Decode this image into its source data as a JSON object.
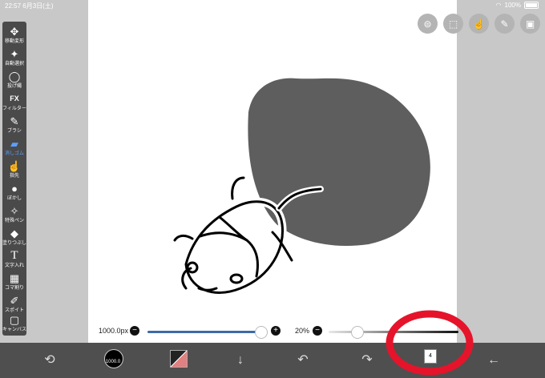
{
  "status": {
    "time": "22:57",
    "date": "6月3日(土)",
    "battery": "100%"
  },
  "tools": [
    {
      "name": "move",
      "label": "移動変形",
      "icon": "✥"
    },
    {
      "name": "autoselect",
      "label": "自動選択",
      "icon": "✦"
    },
    {
      "name": "lasso",
      "label": "投げ縄",
      "icon": "◯"
    },
    {
      "name": "filter",
      "label": "フィルター",
      "icon": "FX"
    },
    {
      "name": "brush",
      "label": "ブラシ",
      "icon": "✎"
    },
    {
      "name": "eraser",
      "label": "消しゴム",
      "icon": "▰"
    },
    {
      "name": "finger",
      "label": "指先",
      "icon": "☝"
    },
    {
      "name": "blur",
      "label": "ぼかし",
      "icon": "●"
    },
    {
      "name": "special",
      "label": "特殊ペン",
      "icon": "✧"
    },
    {
      "name": "fill",
      "label": "塗りつぶし",
      "icon": "◆"
    },
    {
      "name": "text",
      "label": "文字入れ",
      "icon": "T"
    },
    {
      "name": "frame",
      "label": "コマ割り",
      "icon": "▦"
    },
    {
      "name": "dropper",
      "label": "スポイト",
      "icon": "✐"
    },
    {
      "name": "canvas",
      "label": "キャンバス",
      "icon": "▢"
    }
  ],
  "active_tool": "eraser",
  "brush": {
    "size_label": "1000.0px",
    "size_display": "1000.0"
  },
  "opacity": {
    "label": "20%"
  },
  "slider": {
    "minus": "−",
    "plus": "+"
  },
  "layer": {
    "count": "4"
  },
  "colors": {
    "accent": "#3d6aa8",
    "toolbar": "#4a4a4a",
    "bottom": "#4f4f4f",
    "highlight": "#e5142b",
    "shape": "#5e5e5e"
  }
}
